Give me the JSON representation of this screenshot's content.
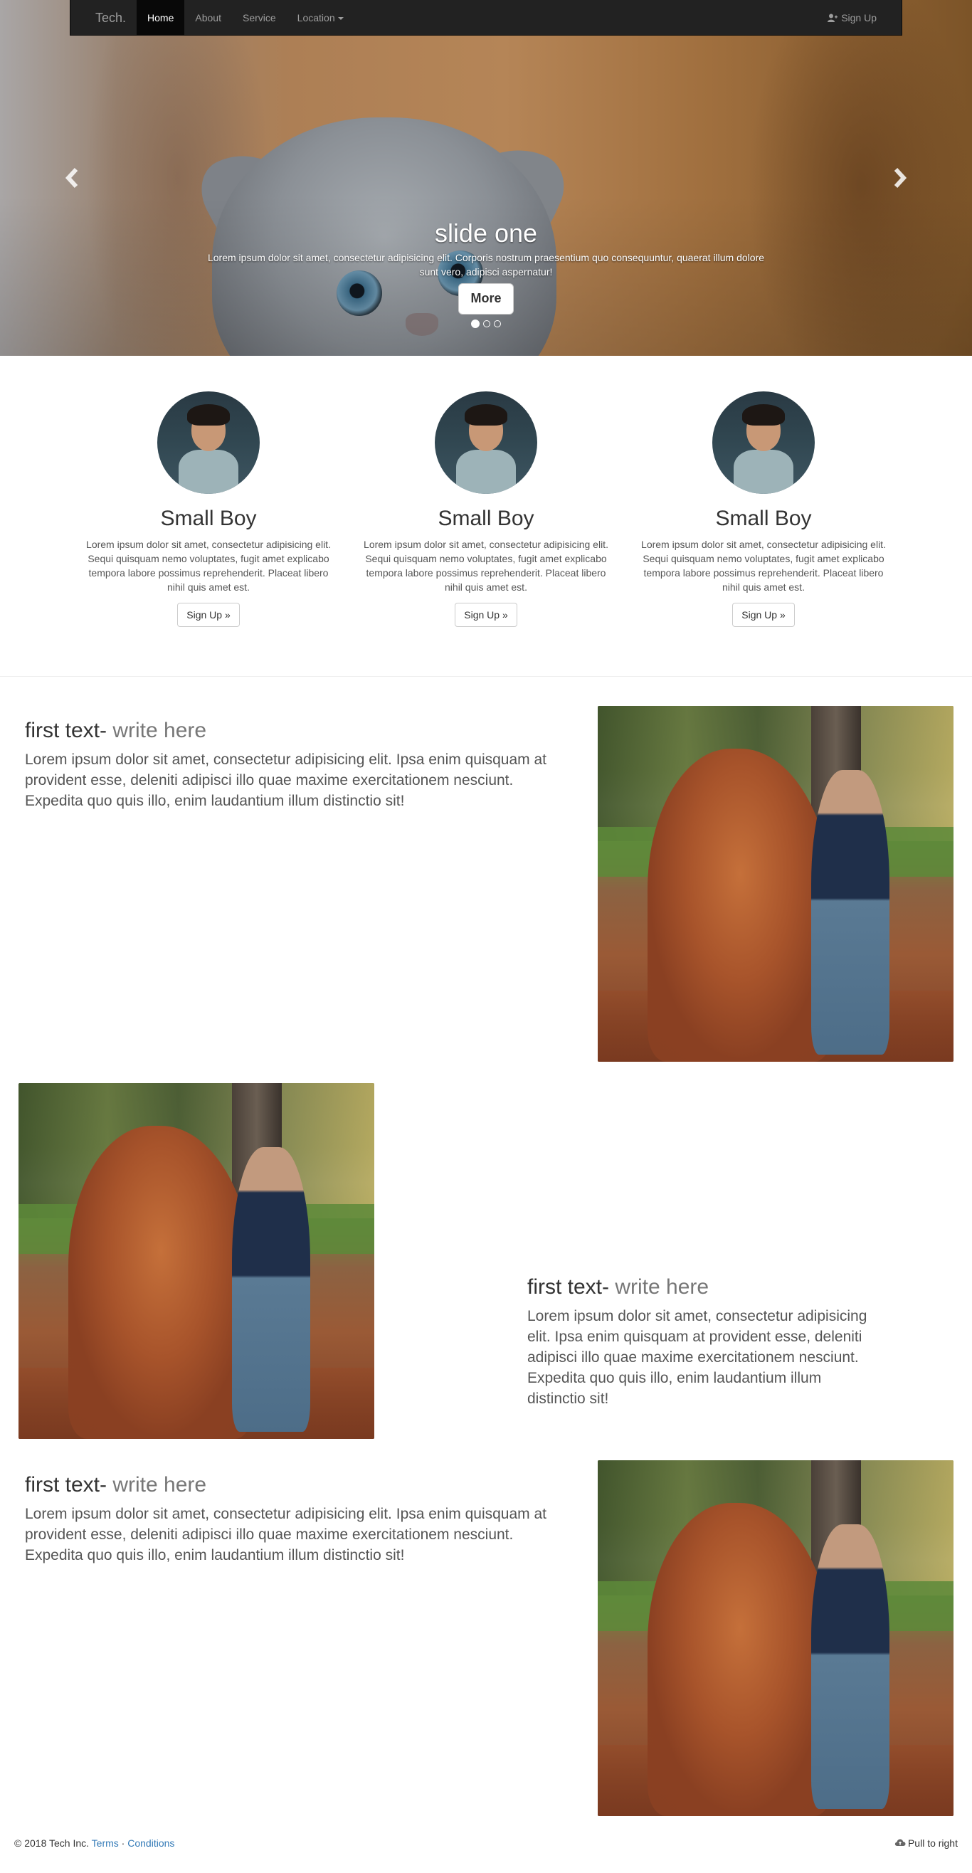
{
  "navbar": {
    "brand": "Tech.",
    "items": [
      {
        "label": "Home",
        "active": true
      },
      {
        "label": "About",
        "active": false
      },
      {
        "label": "Service",
        "active": false
      },
      {
        "label": "Location",
        "active": false,
        "dropdown": true
      }
    ],
    "signup_label": "Sign Up",
    "signup_icon": "user-plus-icon"
  },
  "carousel": {
    "title": "slide one",
    "text": "Lorem ipsum dolor sit amet, consectetur adipisicing elit. Corporis nostrum praesentium quo consequuntur, quaerat illum dolore sunt vero, adipisci aspernatur!",
    "button_label": "More",
    "prev_icon": "chevron-left-icon",
    "next_icon": "chevron-right-icon",
    "slide_count": 3,
    "active_slide": 1
  },
  "columns": [
    {
      "title": "Small Boy",
      "text": "Lorem ipsum dolor sit amet, consectetur adipisicing elit. Sequi quisquam nemo voluptates, fugit amet explicabo tempora labore possimus reprehenderit. Placeat libero nihil quis amet est.",
      "button": "Sign Up »"
    },
    {
      "title": "Small Boy",
      "text": "Lorem ipsum dolor sit amet, consectetur adipisicing elit. Sequi quisquam nemo voluptates, fugit amet explicabo tempora labore possimus reprehenderit. Placeat libero nihil quis amet est.",
      "button": "Sign Up »"
    },
    {
      "title": "Small Boy",
      "text": "Lorem ipsum dolor sit amet, consectetur adipisicing elit. Sequi quisquam nemo voluptates, fugit amet explicabo tempora labore possimus reprehenderit. Placeat libero nihil quis amet est.",
      "button": "Sign Up »"
    }
  ],
  "featurettes": [
    {
      "heading": "first text-",
      "muted": "write here",
      "text": "Lorem ipsum dolor sit amet, consectetur adipisicing elit. Ipsa enim quisquam at provident esse, deleniti adipisci illo quae maxime exercitationem nesciunt. Expedita quo quis illo, enim laudantium illum distinctio sit!"
    },
    {
      "heading": "first text-",
      "muted": "write here",
      "text": "Lorem ipsum dolor sit amet, consectetur adipisicing elit. Ipsa enim quisquam at provident esse, deleniti adipisci illo quae maxime exercitationem nesciunt. Expedita quo quis illo, enim laudantium illum distinctio sit!"
    },
    {
      "heading": "first text-",
      "muted": "write here",
      "text": "Lorem ipsum dolor sit amet, consectetur adipisicing elit. Ipsa enim quisquam at provident esse, deleniti adipisci illo quae maxime exercitationem nesciunt. Expedita quo quis illo, enim laudantium illum distinctio sit!"
    }
  ],
  "footer": {
    "copyright": "© 2018 Tech Inc.",
    "terms": "Terms",
    "separator": "·",
    "conditions": "Conditions",
    "right_label": "Pull to right",
    "right_icon": "cloud-upload-icon"
  },
  "colors": {
    "navbar_bg": "#222222",
    "link": "#337ab7"
  }
}
